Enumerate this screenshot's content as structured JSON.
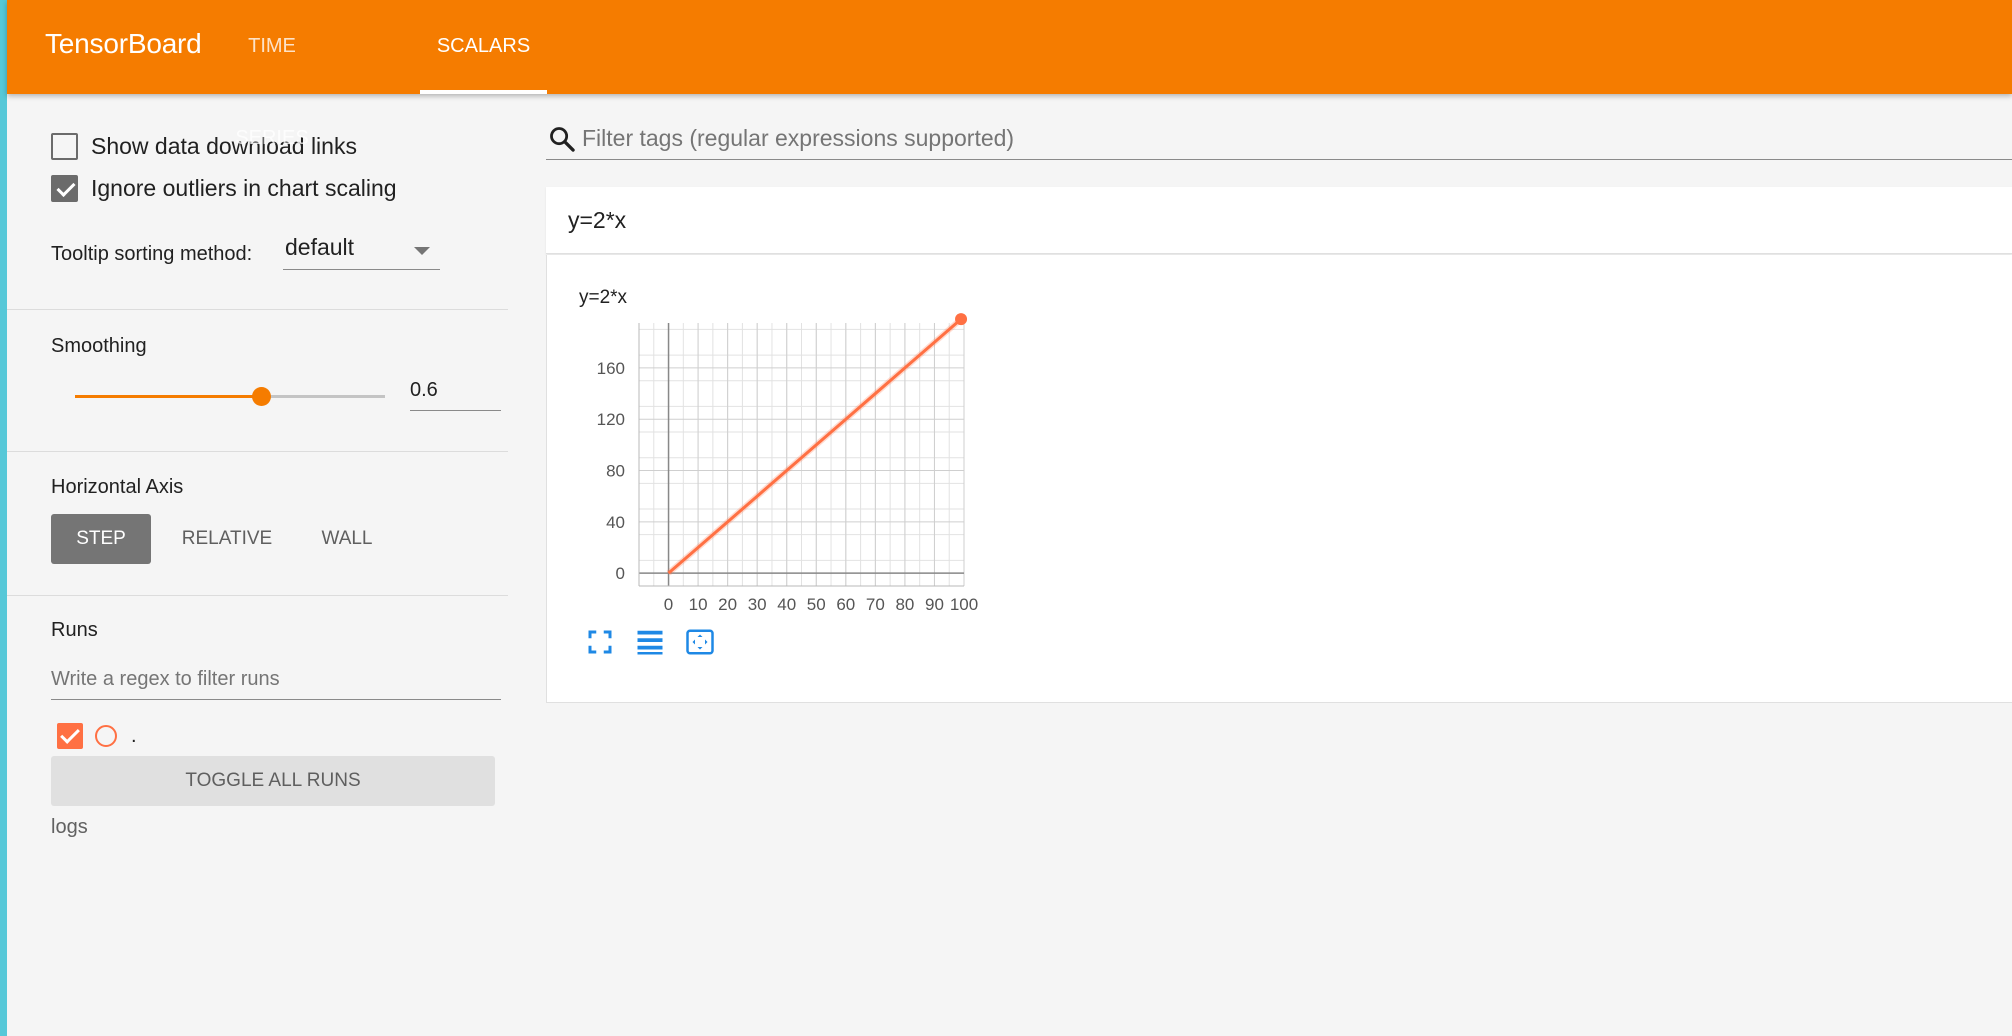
{
  "app": {
    "title": "TensorBoard"
  },
  "tabs": [
    {
      "label": "TIME SERIES",
      "active": false
    },
    {
      "label": "SCALARS",
      "active": true
    }
  ],
  "sidebar": {
    "show_download_links": {
      "label": "Show data download links",
      "checked": false
    },
    "ignore_outliers": {
      "label": "Ignore outliers in chart scaling",
      "checked": true
    },
    "tooltip_sort": {
      "label": "Tooltip sorting method:",
      "value": "default"
    },
    "smoothing": {
      "label": "Smoothing",
      "value": "0.6",
      "fraction": 0.6
    },
    "horizontal_axis": {
      "label": "Horizontal Axis",
      "options": [
        "STEP",
        "RELATIVE",
        "WALL"
      ],
      "selected": "STEP"
    },
    "runs": {
      "label": "Runs",
      "filter_placeholder": "Write a regex to filter runs",
      "items": [
        {
          "name": ".",
          "checked": true,
          "color": "#ff7043"
        }
      ],
      "toggle_label": "TOGGLE ALL RUNS",
      "footer": "logs"
    }
  },
  "main": {
    "filter_placeholder": "Filter tags (regular expressions supported)",
    "card": {
      "title": "y=2*x"
    }
  },
  "colors": {
    "accent": "#f57c00",
    "run_line": "#ff7043",
    "tool_icons": "#1e88e5"
  },
  "icons": [
    "search-icon",
    "fullscreen-icon",
    "toggle-log-scale-icon",
    "fit-domain-icon"
  ],
  "chart_data": {
    "type": "line",
    "title": "y=2*x",
    "xlabel": "",
    "ylabel": "",
    "xlim": [
      -10,
      100
    ],
    "ylim": [
      -10,
      195
    ],
    "x_ticks": [
      0,
      10,
      20,
      30,
      40,
      50,
      60,
      70,
      80,
      90,
      100
    ],
    "y_ticks": [
      0,
      40,
      80,
      120,
      160
    ],
    "grid": true,
    "series": [
      {
        "name": ".",
        "color": "#ff7043",
        "x": [
          0,
          10,
          20,
          30,
          40,
          50,
          60,
          70,
          80,
          90,
          99
        ],
        "y": [
          0,
          20,
          40,
          60,
          80,
          100,
          120,
          140,
          160,
          180,
          198
        ]
      }
    ]
  }
}
